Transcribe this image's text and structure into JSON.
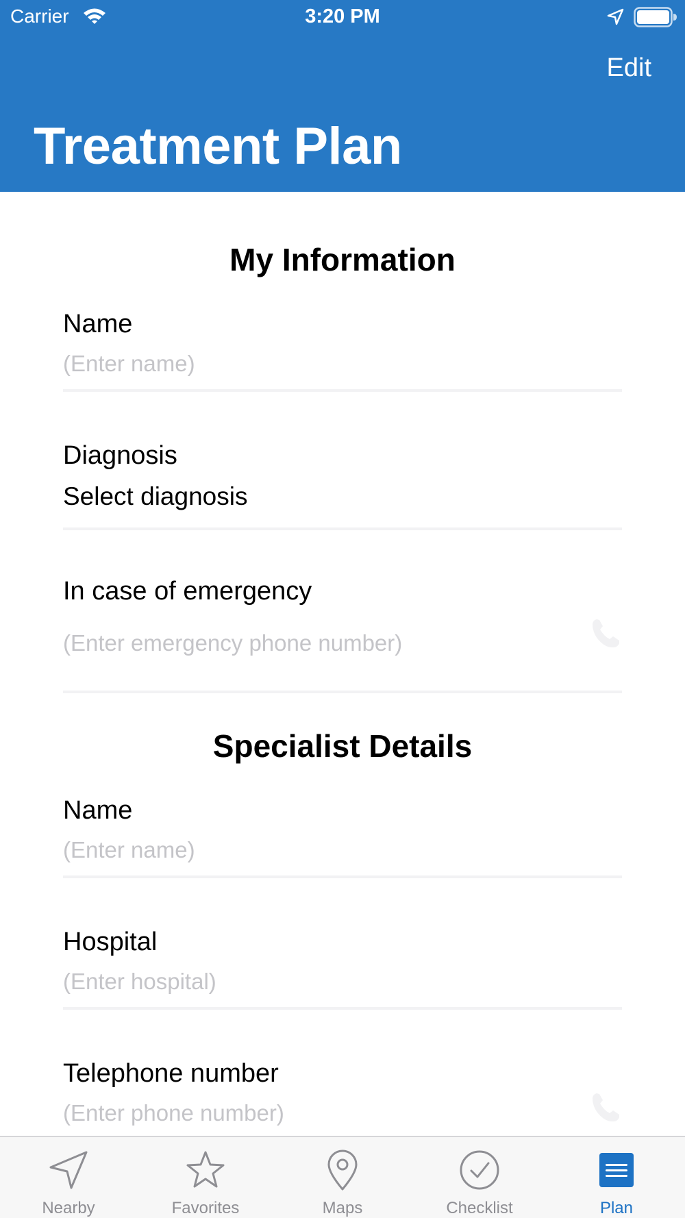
{
  "status_bar": {
    "carrier": "Carrier",
    "time": "3:20 PM"
  },
  "nav": {
    "edit_label": "Edit",
    "title": "Treatment Plan"
  },
  "my_information": {
    "title": "My Information",
    "name_label": "Name",
    "name_placeholder": "(Enter name)",
    "diagnosis_label": "Diagnosis",
    "diagnosis_value": "Select diagnosis",
    "emergency_label": "In case of emergency",
    "emergency_placeholder": "(Enter emergency phone number)"
  },
  "specialist": {
    "title": "Specialist Details",
    "name_label": "Name",
    "name_placeholder": "(Enter name)",
    "hospital_label": "Hospital",
    "hospital_placeholder": "(Enter hospital)",
    "phone_label": "Telephone number",
    "phone_placeholder": "(Enter phone number)"
  },
  "tabs": [
    {
      "label": "Nearby",
      "icon": "navigation-arrow-icon",
      "active": false
    },
    {
      "label": "Favorites",
      "icon": "star-icon",
      "active": false
    },
    {
      "label": "Maps",
      "icon": "map-pin-icon",
      "active": false
    },
    {
      "label": "Checklist",
      "icon": "checkmark-circle-icon",
      "active": false
    },
    {
      "label": "Plan",
      "icon": "list-icon",
      "active": true
    }
  ],
  "colors": {
    "header": "#2779c5",
    "active_tab": "#1d72c4",
    "inactive_tab": "#8e8e93",
    "placeholder": "#c4c4c8",
    "separator": "#f2f2f4"
  }
}
